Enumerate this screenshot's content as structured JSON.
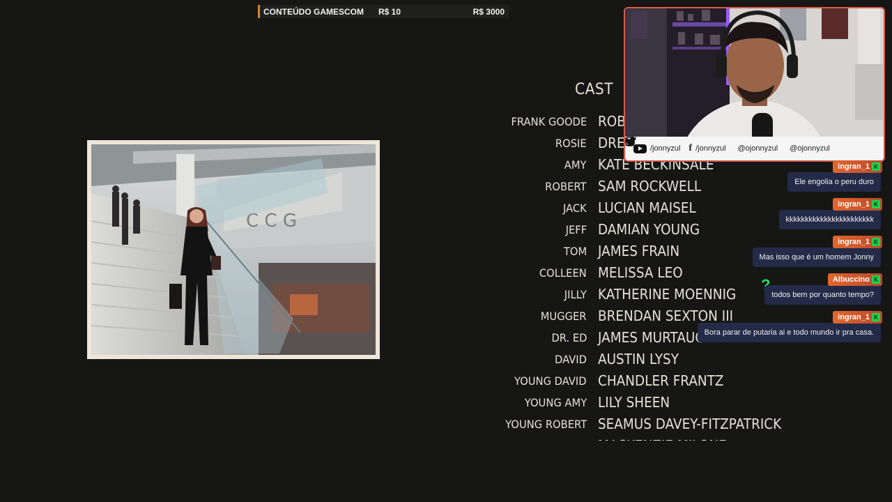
{
  "goal": {
    "title": "CONTEÚDO GAMESCOM",
    "current": "R$ 10",
    "target": "R$ 3000",
    "progress_fraction": 0.0033,
    "accent": "#d9822b"
  },
  "credits": {
    "heading": "CAST",
    "rows": [
      {
        "role": "FRANK GOODE",
        "actor": "ROB"
      },
      {
        "role": "ROSIE",
        "actor": "DRE"
      },
      {
        "role": "AMY",
        "actor": "KATE BECKINSALE"
      },
      {
        "role": "ROBERT",
        "actor": "SAM ROCKWELL"
      },
      {
        "role": "JACK",
        "actor": "LUCIAN MAISEL"
      },
      {
        "role": "JEFF",
        "actor": "DAMIAN YOUNG"
      },
      {
        "role": "TOM",
        "actor": "JAMES FRAIN"
      },
      {
        "role": "COLLEEN",
        "actor": "MELISSA LEO"
      },
      {
        "role": "JILLY",
        "actor": "KATHERINE MOENNIG"
      },
      {
        "role": "MUGGER",
        "actor": "BRENDAN SEXTON III"
      },
      {
        "role": "DR. ED",
        "actor": "JAMES MURTAUGH"
      },
      {
        "role": "DAVID",
        "actor": "AUSTIN LYSY"
      },
      {
        "role": "YOUNG DAVID",
        "actor": "CHANDLER FRANTZ"
      },
      {
        "role": "YOUNG AMY",
        "actor": "LILY SHEEN"
      },
      {
        "role": "YOUNG ROBERT",
        "actor": "SEAMUS DAVEY-FITZPATRICK"
      },
      {
        "role": "YOUNG ROSIE",
        "actor": "MACKENZIE MILONE"
      }
    ]
  },
  "photo": {
    "sign_text": "C C G"
  },
  "socials": {
    "youtube": "/jonnyzul",
    "facebook": "/jonnyzul",
    "twitter": "@ojonnyzul",
    "instagram": "@ojonnyzul"
  },
  "chat": {
    "messages": [
      {
        "user": "ingran_1",
        "text": "Ele engolia o peru duro"
      },
      {
        "user": "ingran_1",
        "text": "kkkkkkkkkkkkkkkkkkkkkkk"
      },
      {
        "user": "ingran_1",
        "text": "Mas isso que é um homem Jonny"
      },
      {
        "user": "Albuccino",
        "text": "todos bem por quanto tempo?"
      },
      {
        "user": "ingran_1",
        "text": "Bora parar de putaria ai e todo mundo ir pra casa."
      }
    ],
    "badge_color": "#19d64a",
    "name_color": "#e3662c",
    "bubble_color": "#242b48"
  }
}
